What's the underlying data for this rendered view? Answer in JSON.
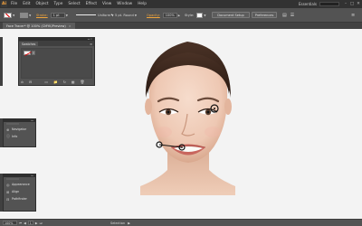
{
  "app": {
    "logo": "Ai"
  },
  "menu": [
    "File",
    "Edit",
    "Object",
    "Type",
    "Select",
    "Effect",
    "View",
    "Window",
    "Help"
  ],
  "window": {
    "workspace": "Essentials",
    "minimize": "–",
    "maximize": "□",
    "close": "✕"
  },
  "controlbar": {
    "stroke_label": "Stroke:",
    "stroke_weight": "1 pt",
    "uniform": "Uniform",
    "brush": "5 pt. Round",
    "opacity_label": "Opacity:",
    "opacity_value": "100%",
    "style_label": "Style:",
    "document_setup": "Document Setup",
    "preferences": "Preferences"
  },
  "document": {
    "tab_title": "Face Tracer* @ 100% (CMYK/Preview)",
    "tab_close": "×"
  },
  "panels": {
    "swatches": {
      "title": "Swatches",
      "menu": "≡",
      "buttons": [
        "ılı",
        "⊟",
        "▭",
        "📁",
        "↻",
        "▦",
        "🗑"
      ]
    },
    "navigator_group": {
      "items": [
        {
          "icon": "⊕",
          "label": "Navigator"
        },
        {
          "icon": "ⓘ",
          "label": "Info"
        }
      ]
    },
    "appearance_group": {
      "items": [
        {
          "icon": "◎",
          "label": "Appearance"
        },
        {
          "icon": "⊞",
          "label": "Align"
        },
        {
          "icon": "⊟",
          "label": "Pathfinder"
        }
      ]
    }
  },
  "statusbar": {
    "zoom": "100%",
    "first": "⏮",
    "prev": "◀",
    "page": "1",
    "next": "▶",
    "last": "⏭",
    "tool": "Selection",
    "arrow": "▶"
  },
  "colors": {
    "accent": "#f0a43b",
    "ui_dark": "#323232",
    "ui_mid": "#535353",
    "anchor": "#111111"
  }
}
